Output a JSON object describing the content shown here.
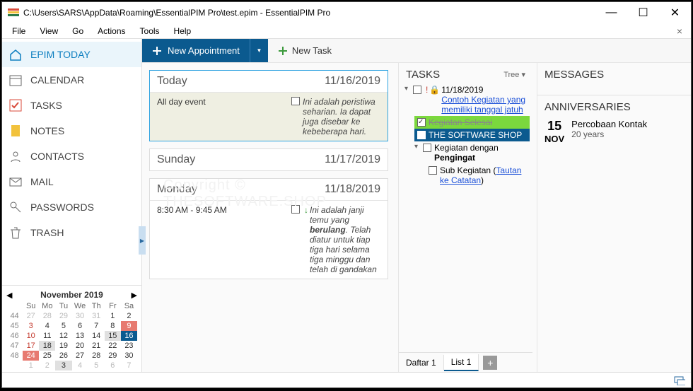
{
  "title": "C:\\Users\\SARS\\AppData\\Roaming\\EssentialPIM Pro\\test.epim - EssentialPIM Pro",
  "menu": [
    "File",
    "View",
    "Go",
    "Actions",
    "Tools",
    "Help"
  ],
  "toolbar": {
    "new_appt": "New Appointment",
    "new_task": "New Task"
  },
  "sidebar": {
    "items": [
      {
        "label": "EPIM TODAY",
        "icon": "home"
      },
      {
        "label": "CALENDAR",
        "icon": "calendar"
      },
      {
        "label": "TASKS",
        "icon": "check"
      },
      {
        "label": "NOTES",
        "icon": "note"
      },
      {
        "label": "CONTACTS",
        "icon": "contact"
      },
      {
        "label": "MAIL",
        "icon": "mail"
      },
      {
        "label": "PASSWORDS",
        "icon": "key"
      },
      {
        "label": "TRASH",
        "icon": "trash"
      }
    ]
  },
  "minical": {
    "month": "November  2019",
    "dow": [
      "Su",
      "Mo",
      "Tu",
      "We",
      "Th",
      "Fr",
      "Sa"
    ],
    "weeks": [
      {
        "wk": "44",
        "d": [
          "27",
          "28",
          "29",
          "30",
          "31",
          "1",
          "2"
        ],
        "cls": [
          "sun grey",
          "grey",
          "grey",
          "grey",
          "grey",
          "",
          ""
        ]
      },
      {
        "wk": "45",
        "d": [
          "3",
          "4",
          "5",
          "6",
          "7",
          "8",
          "9"
        ],
        "cls": [
          "sun",
          "",
          "",
          "",
          "",
          "",
          "red"
        ]
      },
      {
        "wk": "46",
        "d": [
          "10",
          "11",
          "12",
          "13",
          "14",
          "15",
          "16"
        ],
        "cls": [
          "sun",
          "",
          "",
          "",
          "",
          "sel",
          "today"
        ]
      },
      {
        "wk": "47",
        "d": [
          "17",
          "18",
          "19",
          "20",
          "21",
          "22",
          "23"
        ],
        "cls": [
          "sun",
          "sel",
          "",
          "",
          "",
          "",
          ""
        ]
      },
      {
        "wk": "48",
        "d": [
          "24",
          "25",
          "26",
          "27",
          "28",
          "29",
          "30"
        ],
        "cls": [
          "red",
          "",
          "",
          "",
          "",
          "",
          ""
        ]
      },
      {
        "wk": "",
        "d": [
          "1",
          "2",
          "3",
          "4",
          "5",
          "6",
          "7"
        ],
        "cls": [
          "sun grey",
          "grey",
          "sel",
          "grey",
          "grey",
          "grey",
          "grey"
        ]
      }
    ]
  },
  "appointments": {
    "days": [
      {
        "name": "Today",
        "date": "11/16/2019",
        "hl": true,
        "beige": true,
        "rows": [
          {
            "time": "All day event",
            "text": "Ini adalah peristiwa seharian. Ia dapat juga disebar ke kebeberapa hari."
          }
        ]
      },
      {
        "name": "Sunday",
        "date": "11/17/2019",
        "rows": []
      },
      {
        "name": "Monday",
        "date": "11/18/2019",
        "rows": [
          {
            "time": "8:30 AM - 9:45 AM",
            "arrow": true,
            "html": "Ini adalah janji temu yang <b>berulang</b>. Telah diatur untuk tiap tiga hari selama tiga minggu dan telah di gandakan"
          }
        ]
      }
    ]
  },
  "tasks": {
    "title": "TASKS",
    "mode": "Tree",
    "root_date": "11/18/2019",
    "root_link": "Contoh Kegiatan yang memiliki tanggal jatuh",
    "done": "Kegiatan Selesai",
    "selected": "THE SOFTWARE SHOP",
    "reminder_a": "Kegiatan dengan ",
    "reminder_b": "Pengingat",
    "sub_a": "Sub Kegiatan (",
    "sub_link": "Tautan ke Catatan",
    "sub_c": ")",
    "footer": [
      "Daftar 1",
      "List 1"
    ]
  },
  "messages": {
    "title": "MESSAGES"
  },
  "anniversaries": {
    "title": "ANNIVERSARIES",
    "day": "15",
    "month": "NOV",
    "name": "Percobaan Kontak",
    "years": "20 years"
  },
  "watermark": "Copyright © THESOFTWARE.SHOP"
}
